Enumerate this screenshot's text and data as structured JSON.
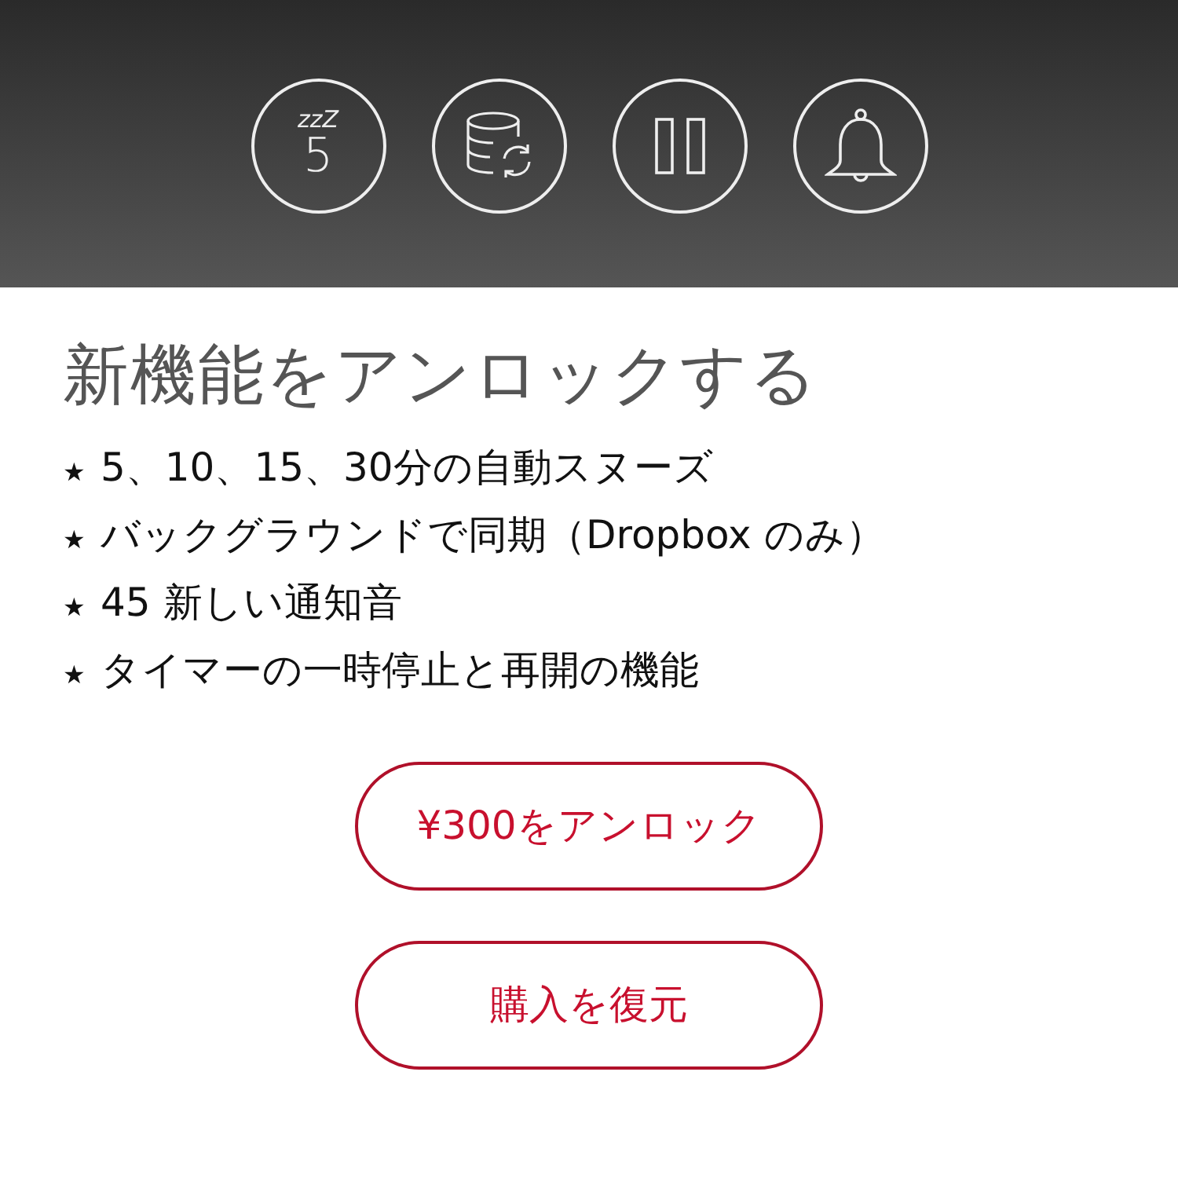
{
  "header_icons": [
    {
      "kind": "snooze",
      "mark": "zzZ",
      "label": "5"
    },
    {
      "kind": "sync"
    },
    {
      "kind": "pause"
    },
    {
      "kind": "bell"
    }
  ],
  "title": "新機能をアンロックする",
  "features": [
    {
      "bullet": "★",
      "text": "5、10、15、30分の自動スヌーズ"
    },
    {
      "bullet": "★",
      "text": "バックグラウンドで同期（Dropbox のみ）"
    },
    {
      "bullet": "★",
      "text": "45 新しい通知音"
    },
    {
      "bullet": "★",
      "text": "タイマーの一時停止と再開の機能"
    }
  ],
  "buttons": [
    {
      "label": "¥300をアンロック"
    },
    {
      "label": "購入を復元"
    }
  ]
}
